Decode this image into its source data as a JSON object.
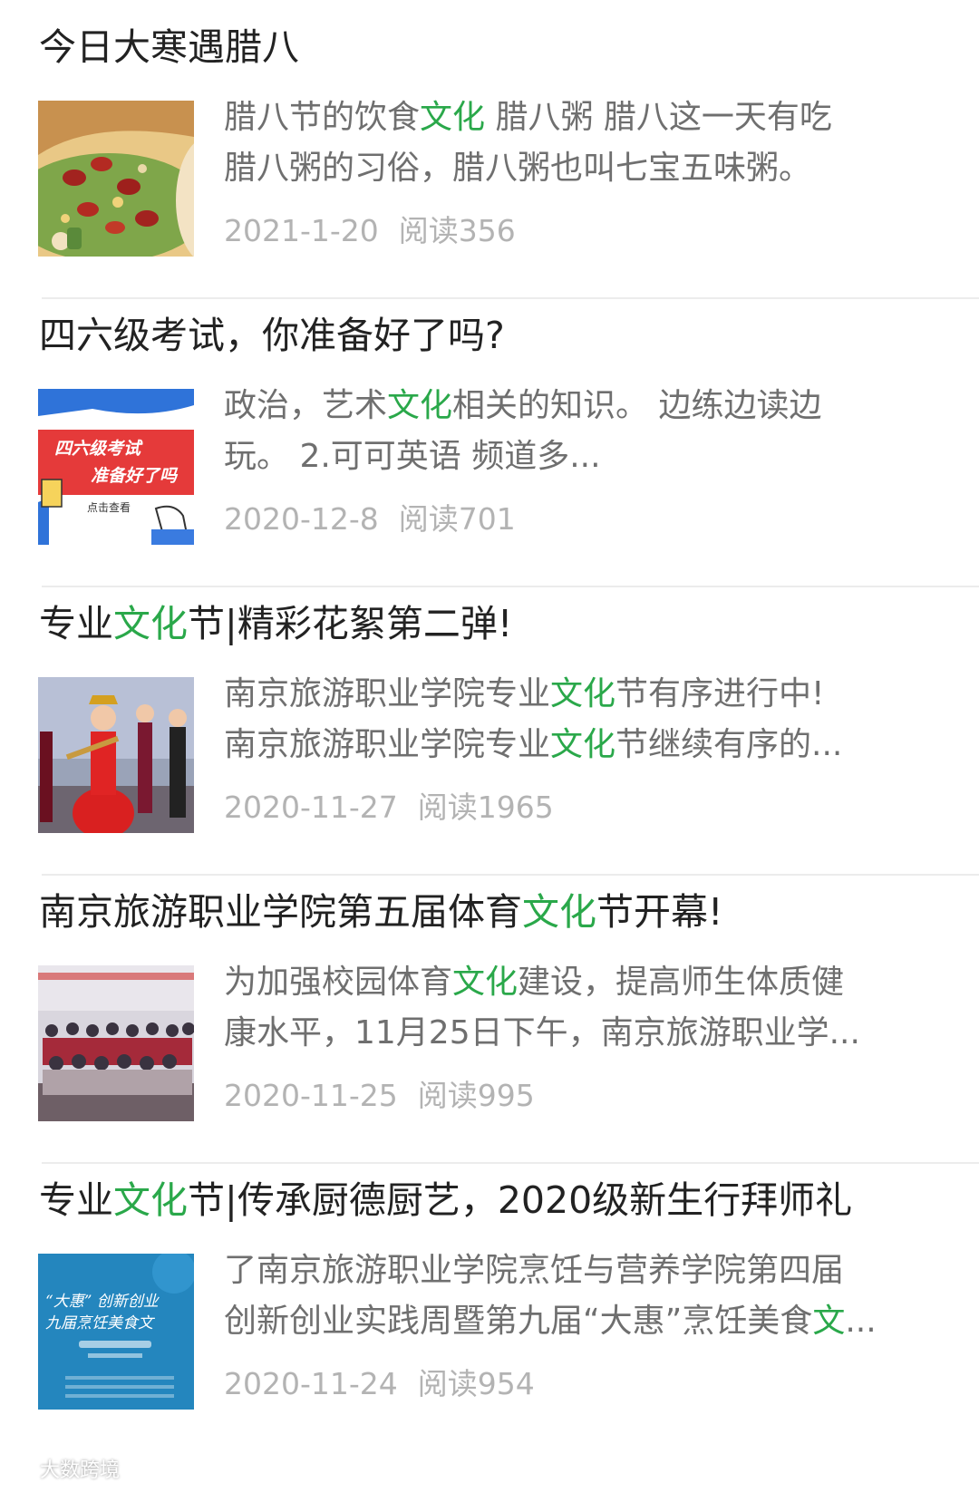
{
  "articles": [
    {
      "title_parts": [
        "今日大寒遇腊八"
      ],
      "desc_line1": [
        "腊八节的饮食",
        "文化",
        " 腊八粥 腊八这一天有吃"
      ],
      "desc_line2": [
        "腊八粥的习俗，腊八粥也叫七宝五味粥。"
      ],
      "date": "2021-1-20",
      "reads": "阅读356",
      "thumb_icon": "laba-porridge-thumbnail"
    },
    {
      "title_parts": [
        "四六级考试，你准备好了吗?"
      ],
      "desc_line1": [
        "政治，艺术",
        "文化",
        "相关的知识。 边练边读边"
      ],
      "desc_line2": [
        "玩。 2.可可英语 频道多..."
      ],
      "date": "2020-12-8",
      "reads": "阅读701",
      "thumb_icon": "cet-exam-thumbnail",
      "thumb_text": [
        "四六级考试",
        "准备好了吗",
        "点击查看"
      ]
    },
    {
      "title_parts": [
        "专业",
        "文化",
        "节|精彩花絮第二弹!"
      ],
      "desc_line1": [
        "南京旅游职业学院专业",
        "文化",
        "节有序进行中!"
      ],
      "desc_line2": [
        "南京旅游职业学院专业",
        "文化",
        "节继续有序的..."
      ],
      "date": "2020-11-27",
      "reads": "阅读1965",
      "thumb_icon": "performance-photo-thumbnail"
    },
    {
      "title_parts": [
        "南京旅游职业学院第五届体育",
        "文化",
        "节开幕!"
      ],
      "desc_line1": [
        "为加强校园体育",
        "文化",
        "建设，提高师生体质健"
      ],
      "desc_line2": [
        "康水平，11月25日下午，南京旅游职业学..."
      ],
      "date": "2020-11-25",
      "reads": "阅读995",
      "thumb_icon": "group-photo-thumbnail"
    },
    {
      "title_parts": [
        "专业",
        "文化",
        "节|传承厨德厨艺，2020级新生行拜师礼"
      ],
      "desc_line1": [
        "了南京旅游职业学院烹饪与营养学院第四届"
      ],
      "desc_line2": [
        "创新创业实践周暨第九届“大惠”烹饪美食",
        "文",
        "..."
      ],
      "date": "2020-11-24",
      "reads": "阅读954",
      "thumb_icon": "cooking-festival-poster-thumbnail",
      "thumb_text": [
        "“大惠” 创新创业",
        "九届烹饪美食文"
      ]
    }
  ],
  "watermark": "大数跨境",
  "colors": {
    "highlight": "#2aa84a",
    "title": "#222222",
    "desc": "#6f6f6f",
    "meta": "#b3b3b3"
  }
}
